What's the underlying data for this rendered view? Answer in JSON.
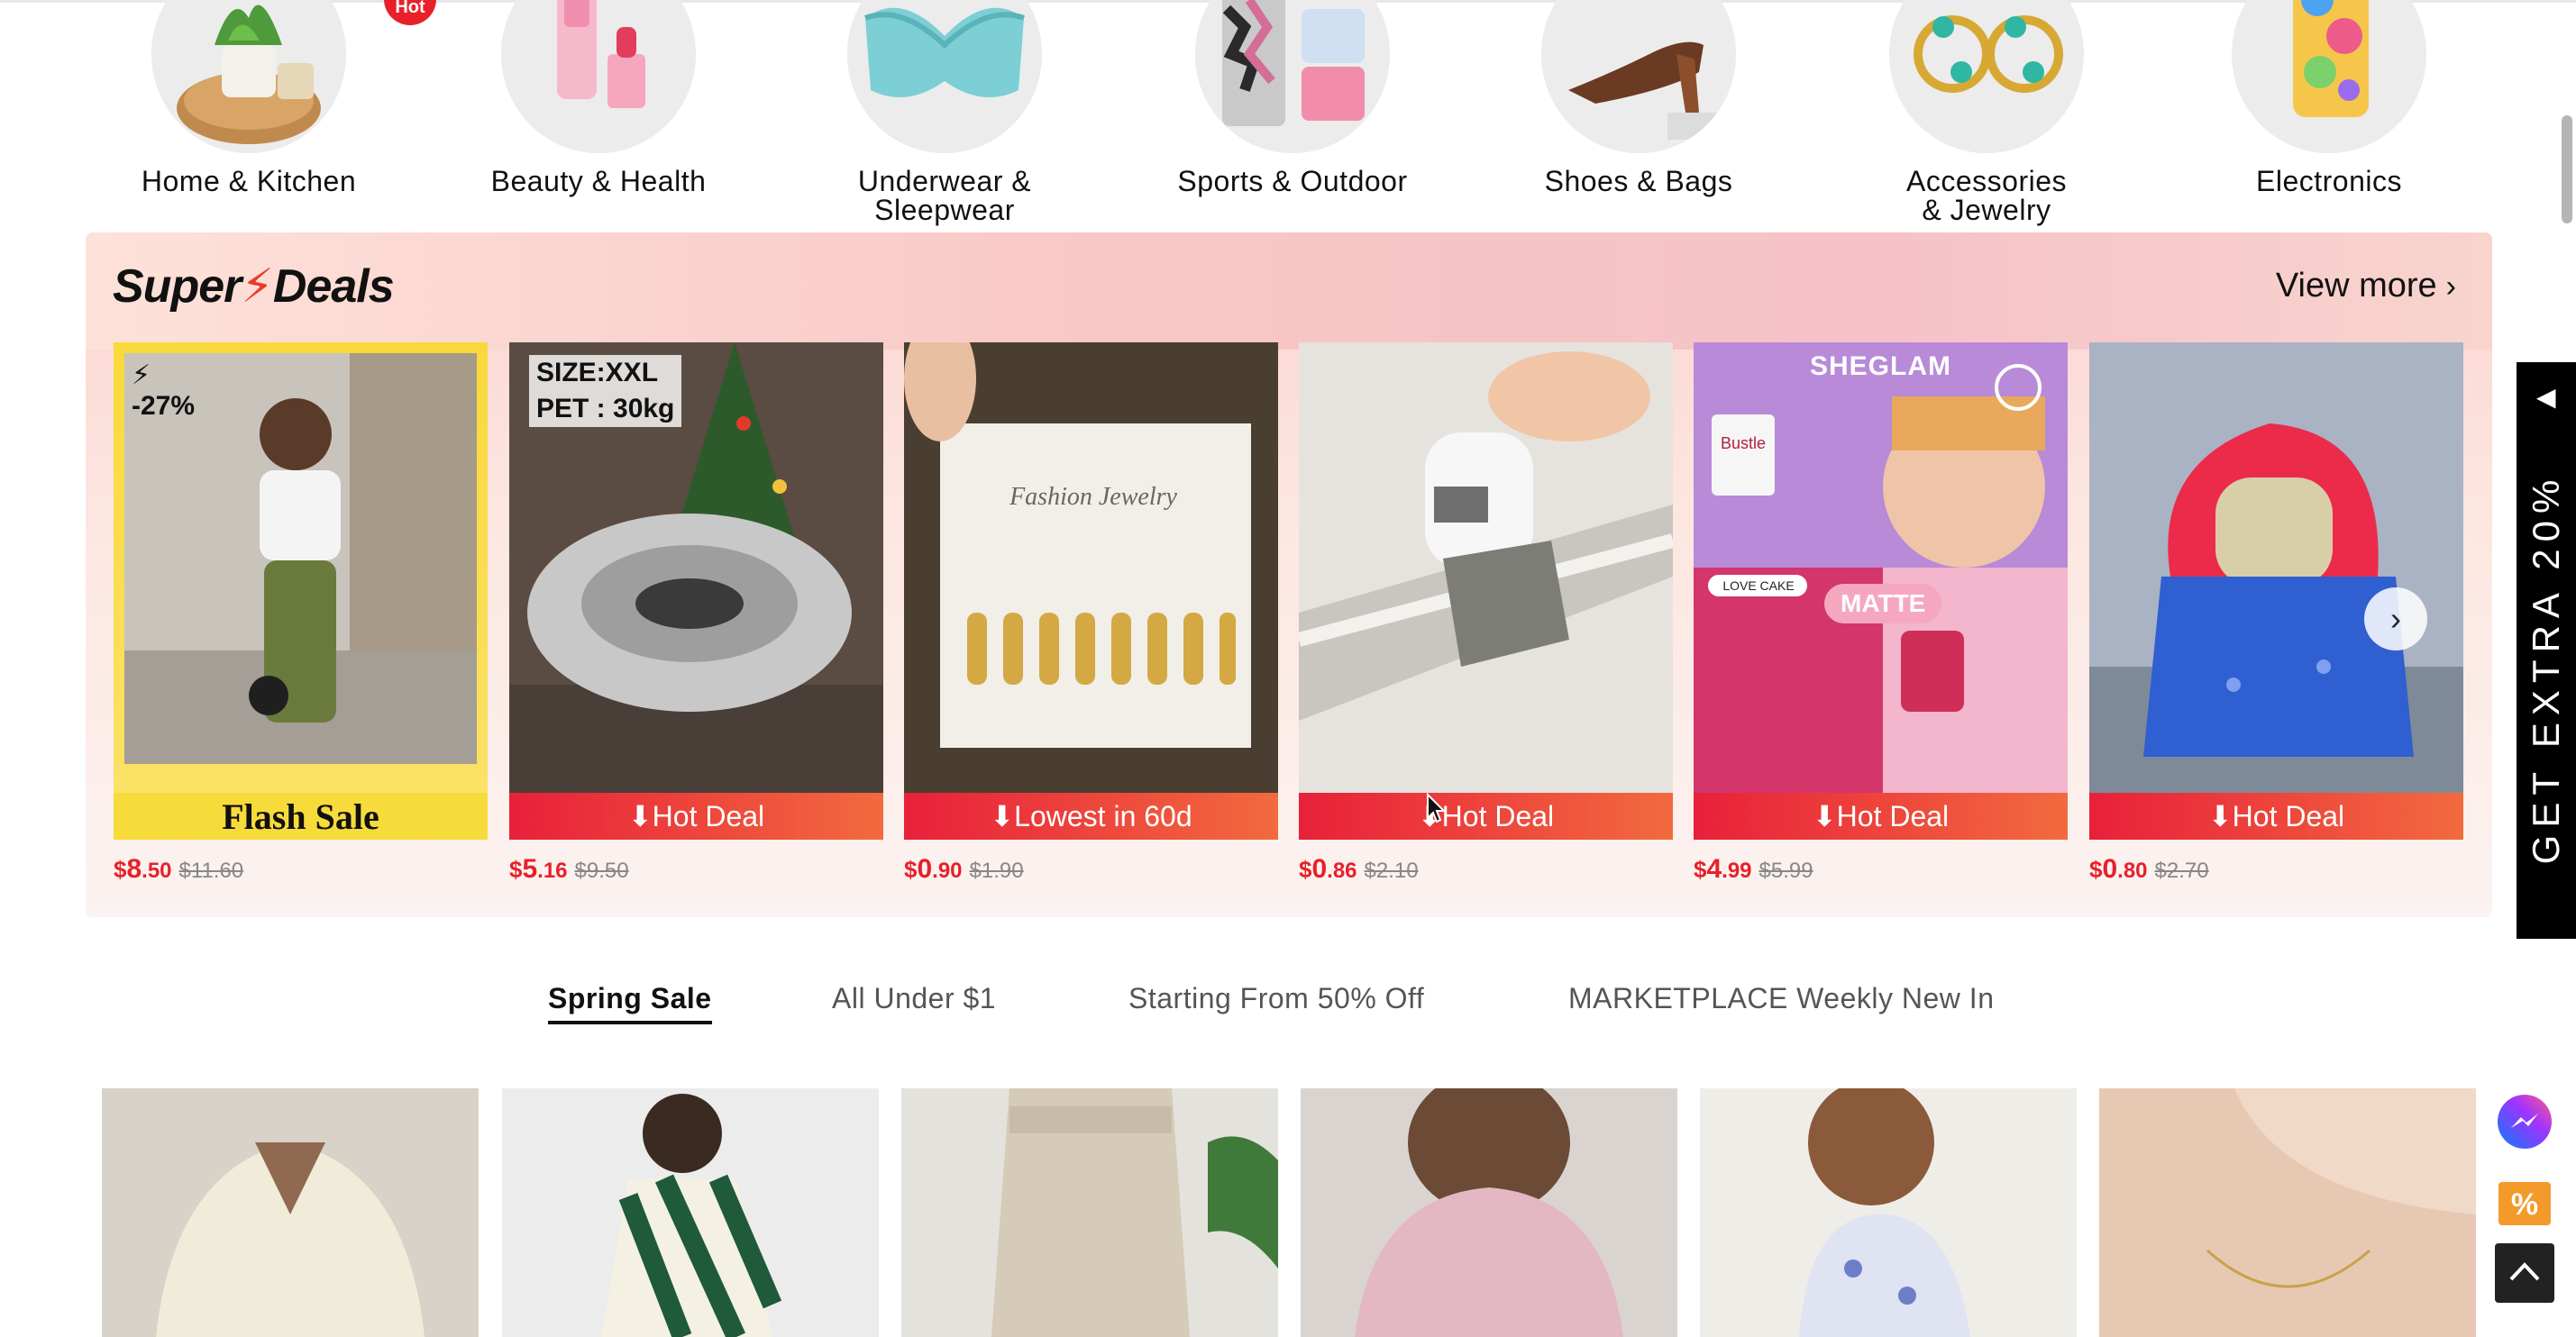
{
  "categories": [
    {
      "label_line1": "Home & Kitchen",
      "label_line2": "",
      "hot_badge": "Hot"
    },
    {
      "label_line1": "Beauty & Health",
      "label_line2": ""
    },
    {
      "label_line1": "Underwear &",
      "label_line2": "Sleepwear"
    },
    {
      "label_line1": "Sports & Outdoor",
      "label_line2": ""
    },
    {
      "label_line1": "Shoes & Bags",
      "label_line2": ""
    },
    {
      "label_line1": "Accessories",
      "label_line2": "& Jewelry"
    },
    {
      "label_line1": "Electronics",
      "label_line2": ""
    }
  ],
  "super_deals": {
    "logo_left": "Super",
    "logo_right": "Deals",
    "view_more": "View more",
    "products": [
      {
        "badge": "Flash Sale",
        "discount": "-27%",
        "price_int": "8",
        "price_dec": ".50",
        "old_price": "$11.60"
      },
      {
        "badge": "Hot Deal",
        "tag_line1": "SIZE:XXL",
        "tag_line2": "PET : 30kg",
        "price_int": "5",
        "price_dec": ".16",
        "old_price": "$9.50"
      },
      {
        "badge": "Lowest in 60d",
        "card_text": "Fashion Jewelry",
        "price_int": "0",
        "price_dec": ".90",
        "old_price": "$1.90"
      },
      {
        "badge": "Hot Deal",
        "price_int": "0",
        "price_dec": ".86",
        "old_price": "$2.10"
      },
      {
        "badge": "Hot Deal",
        "brand": "SHEGLAM",
        "sticker": "Bustle",
        "love_cake": "LOVE CAKE",
        "matte": "MATTE",
        "price_int": "4",
        "price_dec": ".99",
        "old_price": "$5.99"
      },
      {
        "badge": "Hot Deal",
        "price_int": "0",
        "price_dec": ".80",
        "old_price": "$2.70"
      }
    ],
    "currency": "$"
  },
  "tabs": [
    {
      "label": "Spring Sale",
      "active": true
    },
    {
      "label": "All Under $1",
      "active": false
    },
    {
      "label": "Starting From 50% Off",
      "active": false
    },
    {
      "label": "MARKETPLACE Weekly New In",
      "active": false
    }
  ],
  "side_banner": {
    "text": "GET EXTRA 20%"
  },
  "colors": {
    "accent_red": "#e8202a",
    "deal_gradient_start": "#e8203a",
    "deal_gradient_end": "#f26a3e",
    "flash_yellow": "#f7db3a",
    "messenger_blue": "#0a7cff",
    "promo_orange": "#f39a2a"
  },
  "icons": {
    "messenger": "messenger-icon",
    "promo": "percent-icon",
    "back_to_top": "chevron-up-icon",
    "flash": "lightning-icon",
    "arrow_down": "arrow-down-icon"
  }
}
